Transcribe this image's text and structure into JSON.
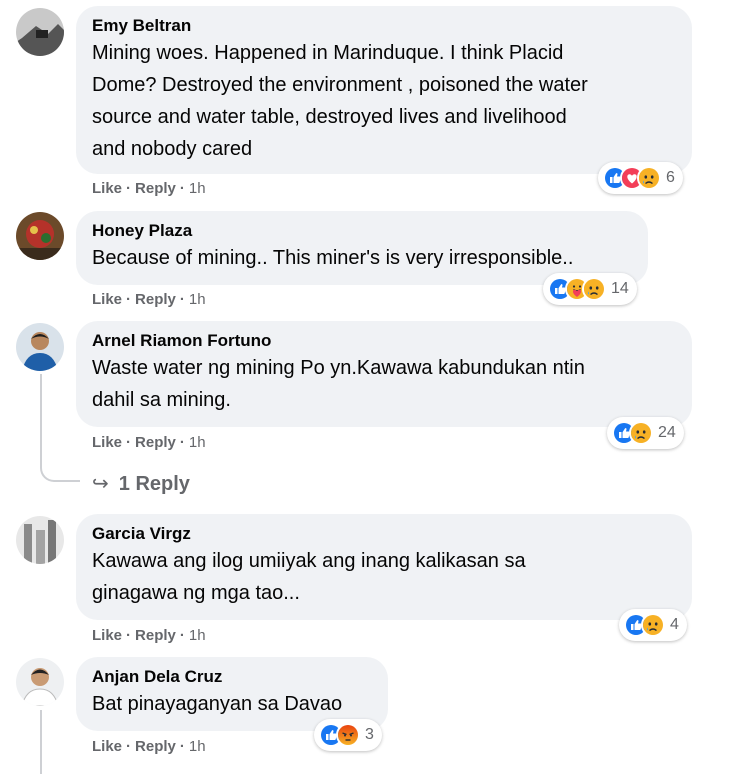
{
  "comments": [
    {
      "author": "Emy Beltran",
      "lines": [
        "Mining woes. Happened in Marinduque. I think Placid",
        "Dome? Destroyed the environment , poisoned the water",
        "source and water table, destroyed lives and livelihood",
        "and nobody cared"
      ],
      "like": "Like",
      "reply": "Reply",
      "time": "1h",
      "reactions": [
        "like-icon",
        "love-icon",
        "sad-icon"
      ],
      "count": "6"
    },
    {
      "author": "Honey Plaza",
      "lines": [
        "Because of mining.. This miner's is very irresponsible.."
      ],
      "like": "Like",
      "reply": "Reply",
      "time": "1h",
      "reactions": [
        "like-icon",
        "care-icon",
        "sad-icon"
      ],
      "count": "14"
    },
    {
      "author": "Arnel Riamon Fortuno",
      "lines": [
        "Waste water ng mining Po yn.Kawawa kabundukan ntin",
        "dahil sa mining."
      ],
      "like": "Like",
      "reply": "Reply",
      "time": "1h",
      "reactions": [
        "like-icon",
        "sad-icon"
      ],
      "count": "24"
    },
    {
      "author": "Garcia Virgz",
      "lines": [
        "Kawawa ang ilog umiiyak ang inang kalikasan sa",
        "ginagawa ng mga tao..."
      ],
      "like": "Like",
      "reply": "Reply",
      "time": "1h",
      "reactions": [
        "like-icon",
        "sad-icon"
      ],
      "count": "4"
    },
    {
      "author": "Anjan Dela Cruz",
      "lines": [
        "Bat pinayaganyan sa Davao"
      ],
      "like": "Like",
      "reply": "Reply",
      "time": "1h",
      "reactions": [
        "like-icon",
        "angry-icon"
      ],
      "count": "3"
    }
  ],
  "view_replies": "1 Reply",
  "colors": {
    "bubble": "#f0f2f5",
    "meta": "#65676b",
    "like": "#1877f2",
    "love": "#f33e58",
    "sad": "#f7b125",
    "angry": "#e9710f"
  }
}
